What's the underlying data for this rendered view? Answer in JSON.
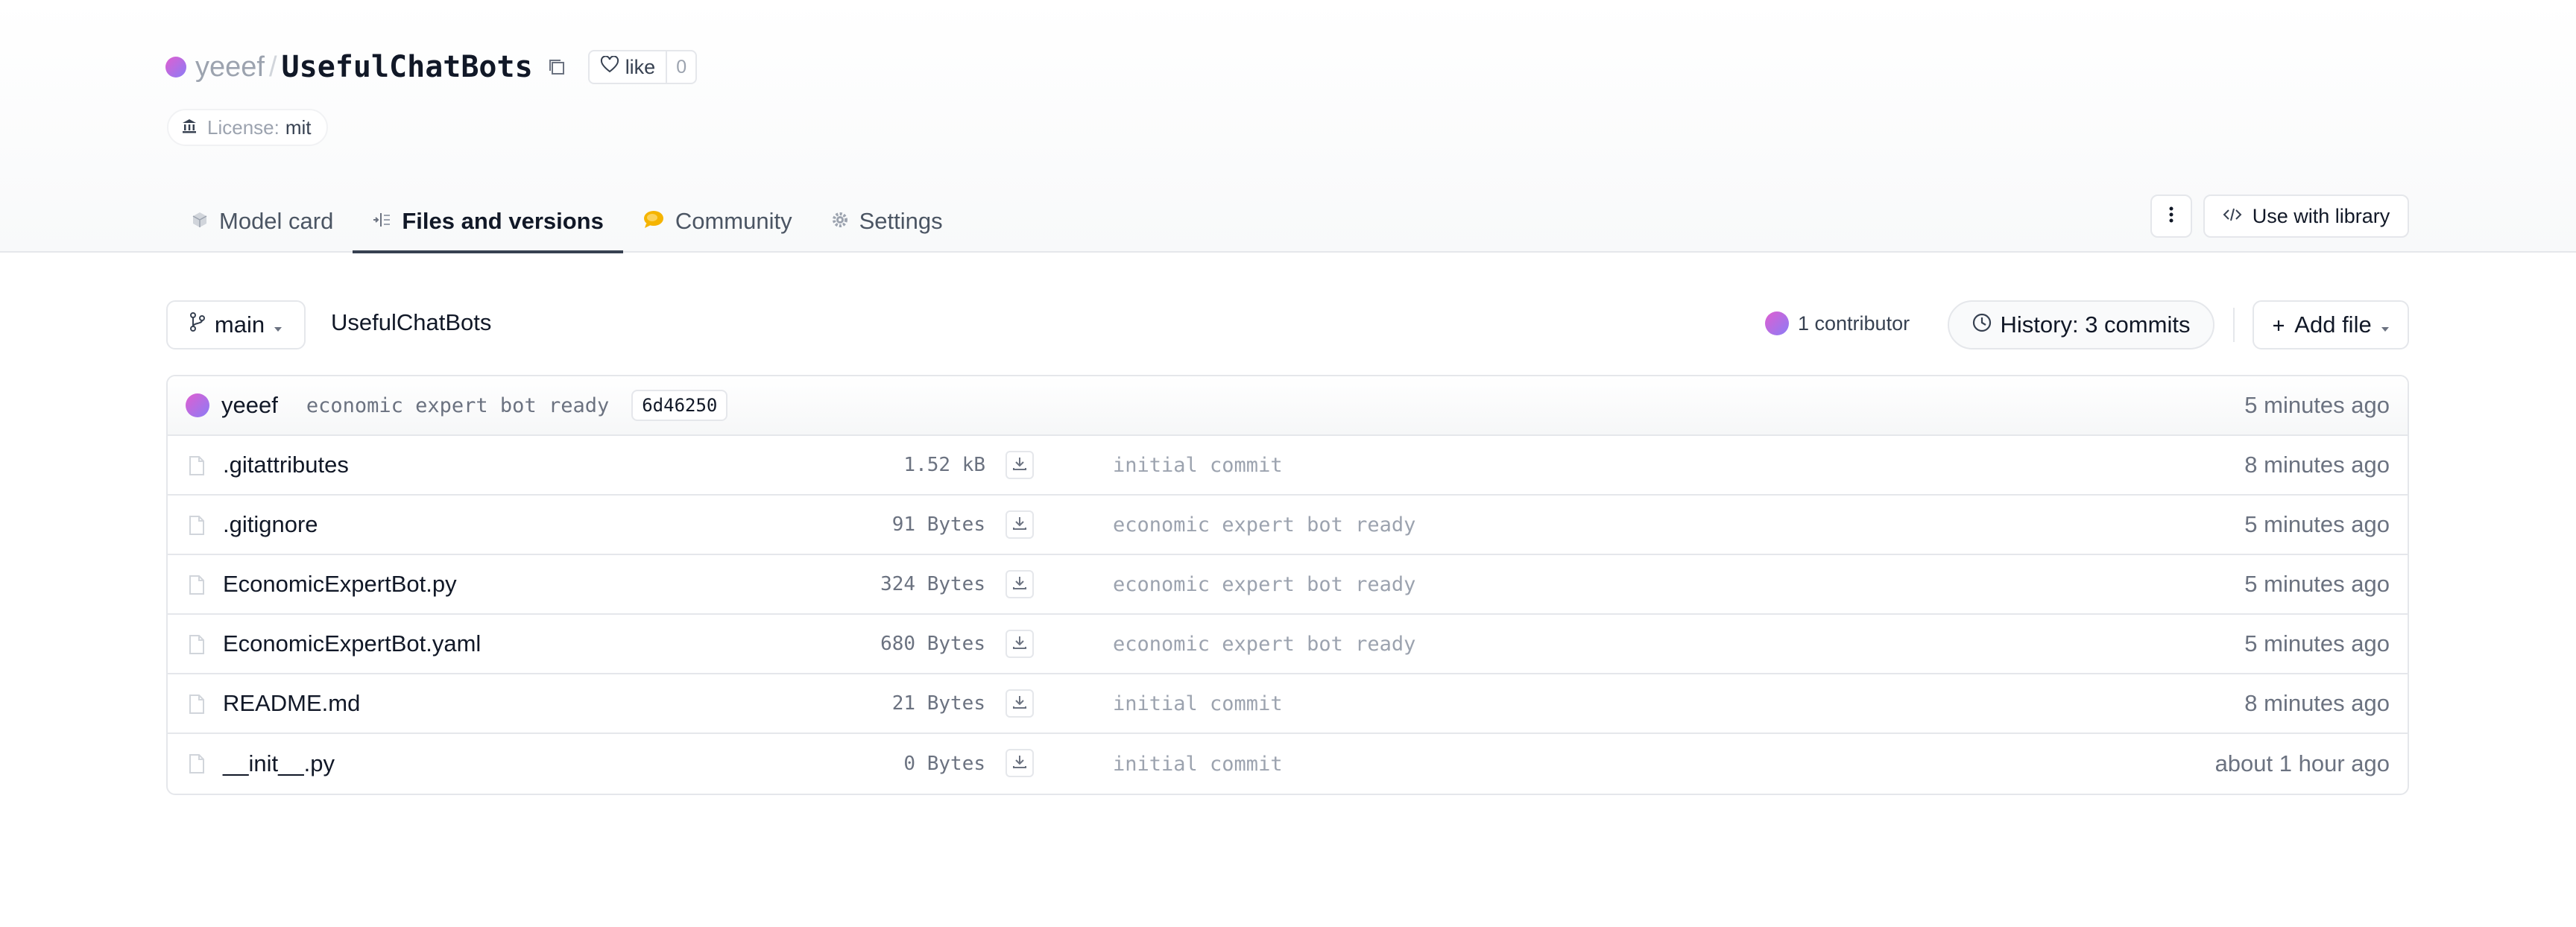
{
  "repo": {
    "owner": "yeeef",
    "separator": "/",
    "name": "UsefulChatBots"
  },
  "like": {
    "label": "like",
    "count": "0"
  },
  "license": {
    "label": "License:",
    "value": "mit"
  },
  "tabs": [
    {
      "label": "Model card",
      "icon": "cube-icon"
    },
    {
      "label": "Files and versions",
      "icon": "files-icon"
    },
    {
      "label": "Community",
      "icon": "community-icon"
    },
    {
      "label": "Settings",
      "icon": "gear-icon"
    }
  ],
  "header_actions": {
    "use_library": "Use with library"
  },
  "toolbar": {
    "branch": "main",
    "breadcrumb": "UsefulChatBots",
    "contributors": "1 contributor",
    "history": "History: 3 commits",
    "add_file": "Add file"
  },
  "last_commit": {
    "author": "yeeef",
    "message": "economic expert bot ready",
    "hash": "6d46250",
    "time": "5 minutes ago"
  },
  "files": [
    {
      "name": ".gitattributes",
      "size": "1.52 kB",
      "message": "initial commit",
      "time": "8 minutes ago"
    },
    {
      "name": ".gitignore",
      "size": "91 Bytes",
      "message": "economic expert bot ready",
      "time": "5 minutes ago"
    },
    {
      "name": "EconomicExpertBot.py",
      "size": "324 Bytes",
      "message": "economic expert bot ready",
      "time": "5 minutes ago"
    },
    {
      "name": "EconomicExpertBot.yaml",
      "size": "680 Bytes",
      "message": "economic expert bot ready",
      "time": "5 minutes ago"
    },
    {
      "name": "README.md",
      "size": "21 Bytes",
      "message": "initial commit",
      "time": "8 minutes ago"
    },
    {
      "name": "__init__.py",
      "size": "0 Bytes",
      "message": "initial commit",
      "time": "about 1 hour ago"
    }
  ],
  "colors": {
    "accent": "#111827",
    "muted": "#6b7280",
    "border": "#e5e7eb",
    "avatar_from": "#e05ed0",
    "avatar_to": "#8b7cf6"
  }
}
